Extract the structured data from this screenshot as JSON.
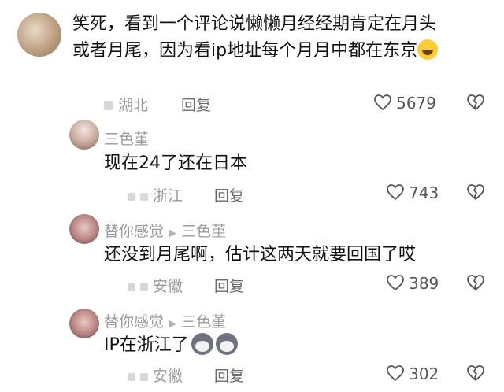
{
  "comments": [
    {
      "text_line1": "笑死，看到一个评论说懒懒月经经期肯定在月头",
      "text_line2": "或者月尾，因为看ip地址每个月月中都在东京",
      "location": "湖北",
      "reply": "回复",
      "likes": "5679"
    },
    {
      "author": "三色堇",
      "text": "现在24了还在日本",
      "location": "浙江",
      "reply": "回复",
      "likes": "743"
    },
    {
      "author": "替你感觉",
      "reply_to": "三色堇",
      "text": "还没到月尾啊，估计这两天就要回国了哎",
      "location": "安徽",
      "reply": "回复",
      "likes": "389"
    },
    {
      "author": "替你感觉",
      "reply_to": "三色堇",
      "text": "IP在浙江了",
      "location": "安徽",
      "reply": "回复",
      "likes": "302"
    }
  ],
  "icons": {
    "like": "heart-outline-icon",
    "dislike": "broken-heart-icon",
    "reply_arrow": "right-triangle-icon",
    "laugh_emoji": "laughing-tears-emoji",
    "dog_emoji": "husky-dog-emoji"
  }
}
